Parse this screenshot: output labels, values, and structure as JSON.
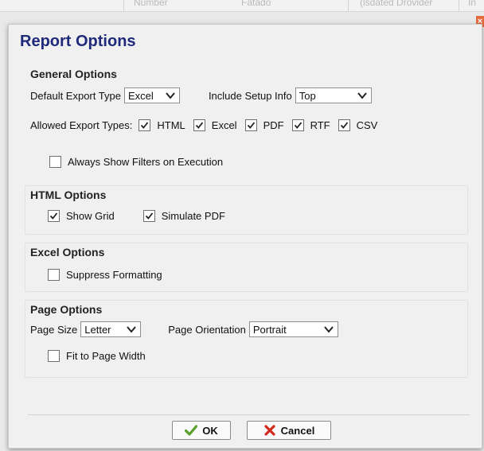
{
  "background_header": {
    "cols": [
      "Number",
      "Fatado",
      "(lsdated Drovider",
      "In"
    ]
  },
  "dialog": {
    "title": "Report Options",
    "close_icon": "×"
  },
  "general": {
    "title": "General Options",
    "default_export_label": "Default Export Type",
    "default_export_value": "Excel",
    "include_setup_label": "Include Setup Info",
    "include_setup_value": "Top",
    "allowed_label": "Allowed Export Types:",
    "allowed_types": [
      {
        "label": "HTML",
        "checked": true
      },
      {
        "label": "Excel",
        "checked": true
      },
      {
        "label": "PDF",
        "checked": true
      },
      {
        "label": "RTF",
        "checked": true
      },
      {
        "label": "CSV",
        "checked": true
      }
    ],
    "always_show_filters_label": "Always Show Filters on Execution",
    "always_show_filters_checked": false
  },
  "html_options": {
    "title": "HTML Options",
    "show_grid_label": "Show Grid",
    "show_grid_checked": true,
    "simulate_pdf_label": "Simulate PDF",
    "simulate_pdf_checked": true
  },
  "excel_options": {
    "title": "Excel Options",
    "suppress_formatting_label": "Suppress Formatting",
    "suppress_formatting_checked": false
  },
  "page_options": {
    "title": "Page Options",
    "page_size_label": "Page Size",
    "page_size_value": "Letter",
    "orientation_label": "Page Orientation",
    "orientation_value": "Portrait",
    "fit_width_label": "Fit to Page Width",
    "fit_width_checked": false
  },
  "buttons": {
    "ok": "OK",
    "cancel": "Cancel"
  },
  "colors": {
    "title": "#1f2a7a",
    "ok_icon": "#5aa02c",
    "cancel_icon": "#d2291f",
    "close": "#e36b3c"
  }
}
